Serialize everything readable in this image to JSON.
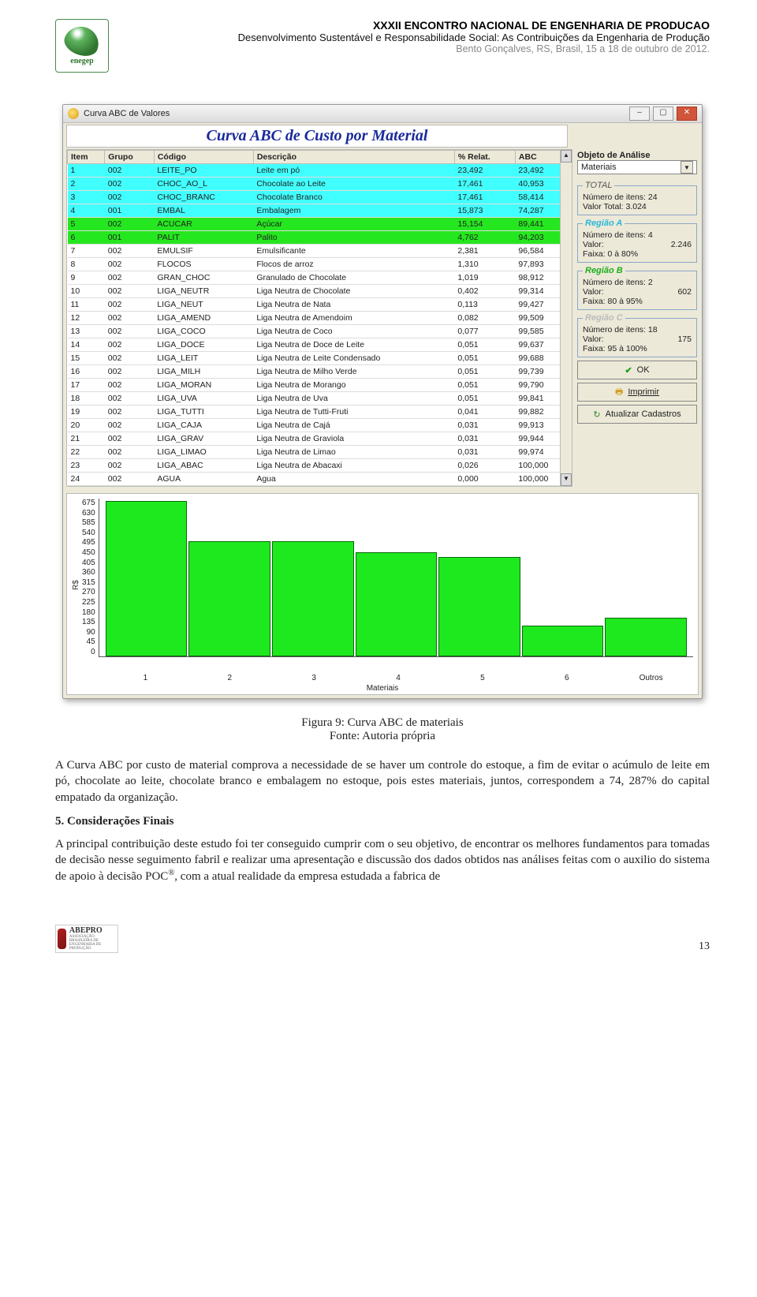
{
  "header": {
    "logo_label": "enegep",
    "line1": "XXXII ENCONTRO NACIONAL DE ENGENHARIA DE PRODUCAO",
    "line2": "Desenvolvimento Sustentável e Responsabilidade Social: As Contribuições da Engenharia de Produção",
    "line3": "Bento Gonçalves, RS, Brasil, 15 a 18 de outubro de 2012."
  },
  "window": {
    "title": "Curva ABC de Valores",
    "app_title": "Curva ABC de Custo por Material",
    "columns": [
      "Item",
      "Grupo",
      "Código",
      "Descrição",
      "% Relat.",
      "ABC"
    ],
    "rows": [
      {
        "item": "1",
        "grupo": "002",
        "codigo": "LEITE_PO",
        "desc": "Leite em pó",
        "rel": "23,492",
        "abc": "23,492",
        "cls": "hlA"
      },
      {
        "item": "2",
        "grupo": "002",
        "codigo": "CHOC_AO_L",
        "desc": "Chocolate ao Leite",
        "rel": "17,461",
        "abc": "40,953",
        "cls": "hlA"
      },
      {
        "item": "3",
        "grupo": "002",
        "codigo": "CHOC_BRANC",
        "desc": "Chocolate Branco",
        "rel": "17,461",
        "abc": "58,414",
        "cls": "hlA"
      },
      {
        "item": "4",
        "grupo": "001",
        "codigo": "EMBAL",
        "desc": "Embalagem",
        "rel": "15,873",
        "abc": "74,287",
        "cls": "hlA"
      },
      {
        "item": "5",
        "grupo": "002",
        "codigo": "ACUCAR",
        "desc": "Açúcar",
        "rel": "15,154",
        "abc": "89,441",
        "cls": "hlB"
      },
      {
        "item": "6",
        "grupo": "001",
        "codigo": "PALIT",
        "desc": "Palito",
        "rel": "4,762",
        "abc": "94,203",
        "cls": "hlB"
      },
      {
        "item": "7",
        "grupo": "002",
        "codigo": "EMULSIF",
        "desc": "Emulsificante",
        "rel": "2,381",
        "abc": "96,584",
        "cls": ""
      },
      {
        "item": "8",
        "grupo": "002",
        "codigo": "FLOCOS",
        "desc": "Flocos de arroz",
        "rel": "1,310",
        "abc": "97,893",
        "cls": ""
      },
      {
        "item": "9",
        "grupo": "002",
        "codigo": "GRAN_CHOC",
        "desc": "Granulado de Chocolate",
        "rel": "1,019",
        "abc": "98,912",
        "cls": ""
      },
      {
        "item": "10",
        "grupo": "002",
        "codigo": "LIGA_NEUTR",
        "desc": "Liga Neutra de Chocolate",
        "rel": "0,402",
        "abc": "99,314",
        "cls": ""
      },
      {
        "item": "11",
        "grupo": "002",
        "codigo": "LIGA_NEUT",
        "desc": "Liga Neutra de Nata",
        "rel": "0,113",
        "abc": "99,427",
        "cls": ""
      },
      {
        "item": "12",
        "grupo": "002",
        "codigo": "LIGA_AMEND",
        "desc": "Liga Neutra de Amendoim",
        "rel": "0,082",
        "abc": "99,509",
        "cls": ""
      },
      {
        "item": "13",
        "grupo": "002",
        "codigo": "LIGA_COCO",
        "desc": "Liga Neutra de Coco",
        "rel": "0,077",
        "abc": "99,585",
        "cls": ""
      },
      {
        "item": "14",
        "grupo": "002",
        "codigo": "LIGA_DOCE",
        "desc": "Liga Neutra de Doce de Leite",
        "rel": "0,051",
        "abc": "99,637",
        "cls": ""
      },
      {
        "item": "15",
        "grupo": "002",
        "codigo": "LIGA_LEIT",
        "desc": "Liga Neutra de Leite Condensado",
        "rel": "0,051",
        "abc": "99,688",
        "cls": ""
      },
      {
        "item": "16",
        "grupo": "002",
        "codigo": "LIGA_MILH",
        "desc": "Liga Neutra de Milho Verde",
        "rel": "0,051",
        "abc": "99,739",
        "cls": ""
      },
      {
        "item": "17",
        "grupo": "002",
        "codigo": "LIGA_MORAN",
        "desc": "Liga Neutra de Morango",
        "rel": "0,051",
        "abc": "99,790",
        "cls": ""
      },
      {
        "item": "18",
        "grupo": "002",
        "codigo": "LIGA_UVA",
        "desc": "Liga Neutra de Uva",
        "rel": "0,051",
        "abc": "99,841",
        "cls": ""
      },
      {
        "item": "19",
        "grupo": "002",
        "codigo": "LIGA_TUTTI",
        "desc": "Liga Neutra de Tutti-Fruti",
        "rel": "0,041",
        "abc": "99,882",
        "cls": ""
      },
      {
        "item": "20",
        "grupo": "002",
        "codigo": "LIGA_CAJA",
        "desc": "Liga Neutra de Cajá",
        "rel": "0,031",
        "abc": "99,913",
        "cls": ""
      },
      {
        "item": "21",
        "grupo": "002",
        "codigo": "LIGA_GRAV",
        "desc": "Liga Neutra de Graviola",
        "rel": "0,031",
        "abc": "99,944",
        "cls": ""
      },
      {
        "item": "22",
        "grupo": "002",
        "codigo": "LIGA_LIMAO",
        "desc": "Liga Neutra de Limao",
        "rel": "0,031",
        "abc": "99,974",
        "cls": ""
      },
      {
        "item": "23",
        "grupo": "002",
        "codigo": "LIGA_ABAC",
        "desc": "Liga Neutra de Abacaxi",
        "rel": "0,026",
        "abc": "100,000",
        "cls": ""
      },
      {
        "item": "24",
        "grupo": "002",
        "codigo": "AGUA",
        "desc": "Agua",
        "rel": "0,000",
        "abc": "100,000",
        "cls": ""
      }
    ],
    "side": {
      "analysis_label": "Objeto de Análise",
      "analysis_value": "Materiais",
      "total": {
        "legend": "TOTAL",
        "itens_label": "Número de itens:",
        "itens": "24",
        "valor_label": "Valor Total:",
        "valor": "3.024"
      },
      "regA": {
        "legend": "Região A",
        "itens_label": "Número de itens:",
        "itens": "4",
        "valor_label": "Valor:",
        "valor": "2.246",
        "faixa_label": "Faixa:",
        "faixa": "0 à 80%"
      },
      "regB": {
        "legend": "Região B",
        "itens_label": "Número de itens:",
        "itens": "2",
        "valor_label": "Valor:",
        "valor": "602",
        "faixa_label": "Faixa:",
        "faixa": "80 à 95%"
      },
      "regC": {
        "legend": "Região C",
        "itens_label": "Número de itens:",
        "itens": "18",
        "valor_label": "Valor:",
        "valor": "175",
        "faixa_label": "Faixa:",
        "faixa": "95 à 100%"
      },
      "ok_label": "OK",
      "print_label": "Imprimir",
      "refresh_label": "Atualizar Cadastros"
    }
  },
  "chart_data": {
    "type": "bar",
    "categories": [
      "1",
      "2",
      "3",
      "4",
      "5",
      "6",
      "Outros"
    ],
    "values": [
      688,
      510,
      510,
      463,
      440,
      138,
      170
    ],
    "y_ticks": [
      "675",
      "630",
      "585",
      "540",
      "495",
      "450",
      "405",
      "360",
      "315",
      "270",
      "225",
      "180",
      "135",
      "90",
      "45",
      "0"
    ],
    "ylim": [
      0,
      700
    ],
    "xlabel": "Materiais",
    "ylabel": "R$"
  },
  "caption": {
    "title": "Figura 9: Curva ABC de materiais",
    "source": "Fonte: Autoria própria"
  },
  "body": {
    "p1": "A Curva ABC por custo de material comprova a necessidade de se haver um controle do estoque, a fim de evitar o acúmulo de leite em pó, chocolate ao leite, chocolate branco e embalagem no estoque, pois estes materiais, juntos, correspondem a 74, 287% do capital empatado da organização.",
    "h2": "5. Considerações Finais",
    "p2a": "A principal contribuição deste estudo foi ter conseguido cumprir com o seu objetivo, de encontrar os melhores fundamentos para tomadas de decisão nesse seguimento fabril e realizar uma apresentação e discussão dos dados obtidos nas análises feitas com o auxilio do sistema de apoio à decisão POC",
    "p2sup": "®",
    "p2b": ", com a atual realidade da empresa estudada a fabrica de"
  },
  "footer": {
    "logo_text": "ABEPRO",
    "logo_sub": "ASSOCIAÇÃO BRASILEIRA DE ENGENHARIA DE PRODUÇÃO",
    "page_number": "13"
  }
}
